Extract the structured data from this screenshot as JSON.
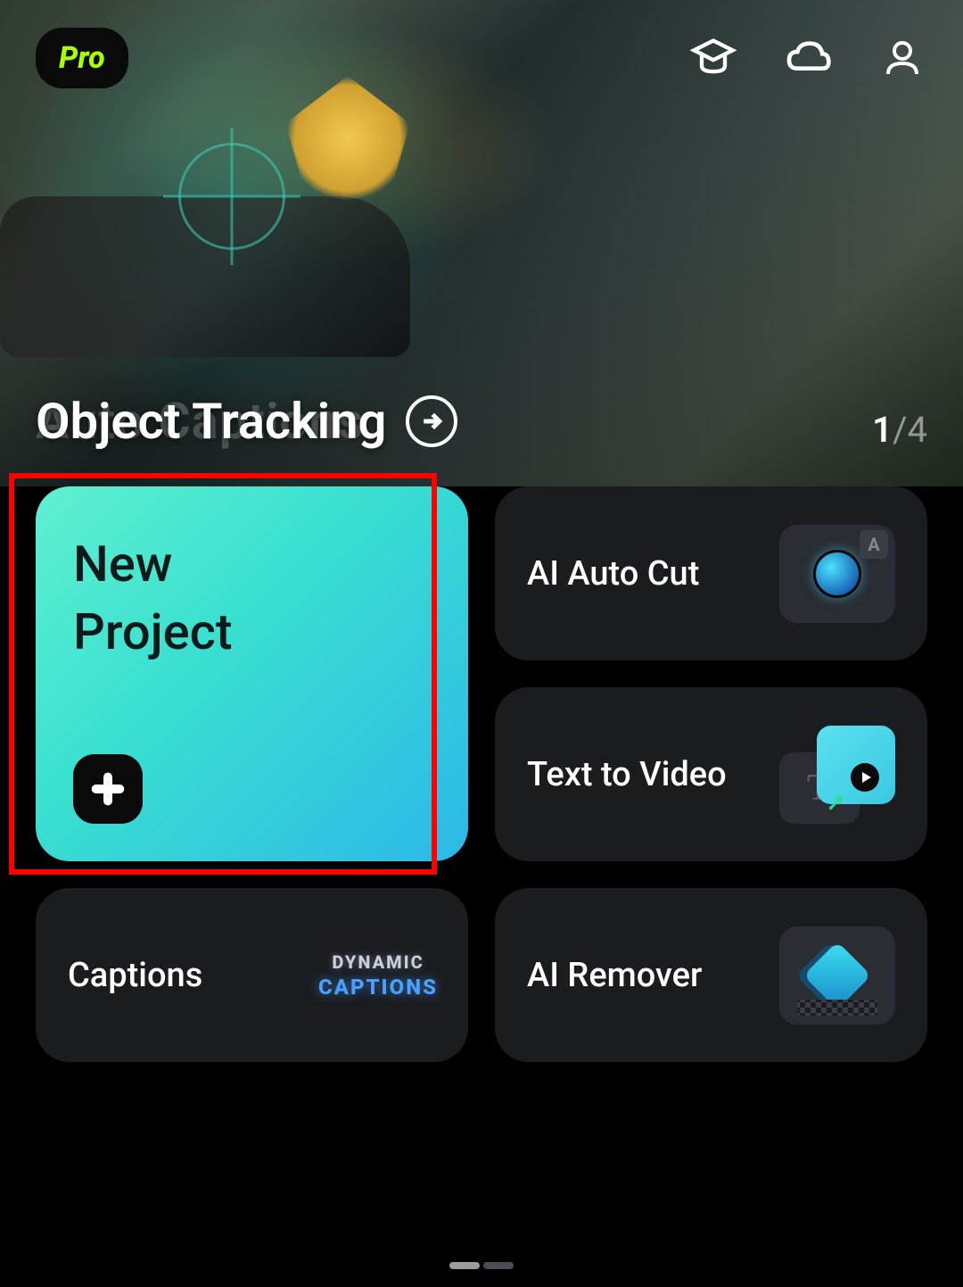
{
  "header": {
    "pro_label": "Pro"
  },
  "hero": {
    "title": "Object Tracking",
    "ghost_title": "Auto Captions",
    "page_current": "1",
    "page_total": "4"
  },
  "cards": {
    "new_project": "New\nProject",
    "ai_auto_cut": "AI Auto Cut",
    "text_to_video": "Text to Video",
    "captions": "Captions",
    "captions_art_line1": "DYNAMIC",
    "captions_art_line2": "CAPTIONS",
    "ai_remover": "AI Remover",
    "t2v_letter": "T"
  }
}
